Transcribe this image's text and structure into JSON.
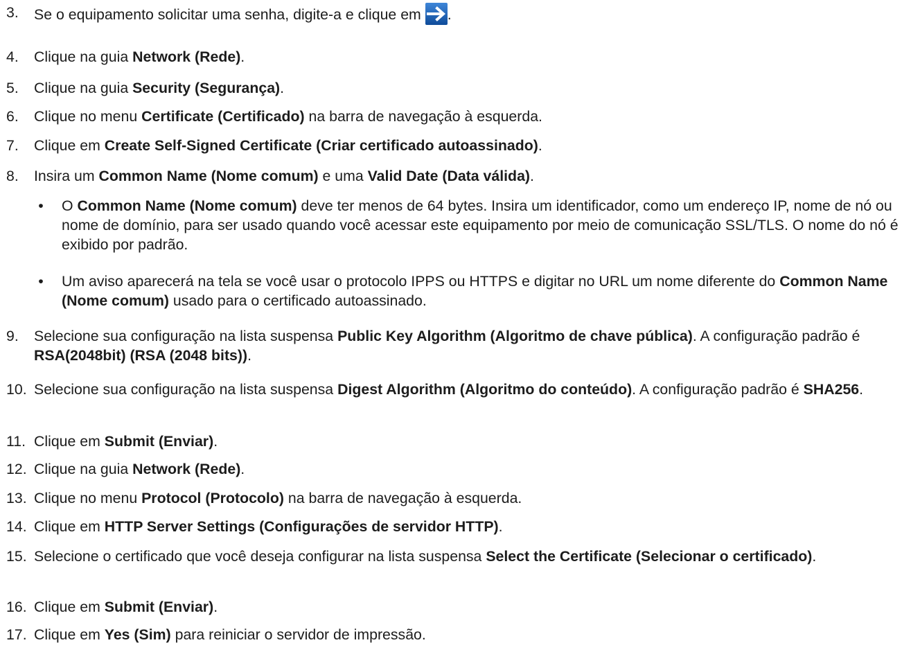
{
  "steps": [
    {
      "num": "3.",
      "parts": [
        {
          "t": "Se o equipamento solicitar uma senha, digite-a e clique em "
        },
        {
          "icon": "arrow-right-icon"
        },
        {
          "t": "."
        }
      ]
    },
    {
      "num": "4.",
      "parts": [
        {
          "t": "Clique na guia "
        },
        {
          "b": "Network (Rede)"
        },
        {
          "t": "."
        }
      ]
    },
    {
      "num": "5.",
      "parts": [
        {
          "t": "Clique na guia "
        },
        {
          "b": "Security (Segurança)"
        },
        {
          "t": "."
        }
      ]
    },
    {
      "num": "6.",
      "parts": [
        {
          "t": "Clique no menu "
        },
        {
          "b": "Certificate (Certificado)"
        },
        {
          "t": " na barra de navegação à esquerda."
        }
      ]
    },
    {
      "num": "7.",
      "parts": [
        {
          "t": "Clique em "
        },
        {
          "b": "Create Self-Signed Certificate (Criar certificado autoassinado)"
        },
        {
          "t": "."
        }
      ]
    },
    {
      "num": "8.",
      "parts": [
        {
          "t": "Insira um "
        },
        {
          "b": "Common Name (Nome comum)"
        },
        {
          "t": " e uma "
        },
        {
          "b": "Valid Date (Data válida)"
        },
        {
          "t": "."
        }
      ]
    },
    {
      "num": "9.",
      "parts": [
        {
          "t": "Selecione sua configuração na lista suspensa "
        },
        {
          "b": "Public Key Algorithm (Algoritmo de chave pública)"
        },
        {
          "t": ". A configuração padrão é "
        },
        {
          "b": "RSA(2048bit) (RSA (2048 bits))"
        },
        {
          "t": "."
        }
      ]
    },
    {
      "num": "10.",
      "parts": [
        {
          "t": "Selecione sua configuração na lista suspensa "
        },
        {
          "b": "Digest Algorithm (Algoritmo do conteúdo)"
        },
        {
          "t": ". A configuração padrão é "
        },
        {
          "b": "SHA256"
        },
        {
          "t": "."
        }
      ]
    },
    {
      "num": "11.",
      "parts": [
        {
          "t": "Clique em "
        },
        {
          "b": "Submit (Enviar)"
        },
        {
          "t": "."
        }
      ]
    },
    {
      "num": "12.",
      "parts": [
        {
          "t": "Clique na guia "
        },
        {
          "b": "Network (Rede)"
        },
        {
          "t": "."
        }
      ]
    },
    {
      "num": "13.",
      "parts": [
        {
          "t": "Clique no menu "
        },
        {
          "b": "Protocol (Protocolo)"
        },
        {
          "t": " na barra de navegação à esquerda."
        }
      ]
    },
    {
      "num": "14.",
      "parts": [
        {
          "t": "Clique em "
        },
        {
          "b": "HTTP Server Settings (Configurações de servidor HTTP)"
        },
        {
          "t": "."
        }
      ]
    },
    {
      "num": "15.",
      "parts": [
        {
          "t": "Selecione o certificado que você deseja configurar na lista suspensa "
        },
        {
          "b": "Select the Certificate (Selecionar o certificado)"
        },
        {
          "t": "."
        }
      ]
    },
    {
      "num": "16.",
      "parts": [
        {
          "t": "Clique em "
        },
        {
          "b": "Submit (Enviar)"
        },
        {
          "t": "."
        }
      ]
    },
    {
      "num": "17.",
      "parts": [
        {
          "t": "Clique em "
        },
        {
          "b": "Yes (Sim)"
        },
        {
          "t": " para reiniciar o servidor de impressão."
        }
      ]
    }
  ],
  "bullets": [
    {
      "mark": "•",
      "parts": [
        {
          "t": "O "
        },
        {
          "b": "Common Name (Nome comum)"
        },
        {
          "t": " deve ter menos de 64 bytes. Insira um identificador, como um endereço IP, nome de nó ou nome de domínio, para ser usado quando você acessar este equipamento por meio de comunicação SSL/TLS. O nome do nó é exibido por padrão."
        }
      ]
    },
    {
      "mark": "•",
      "parts": [
        {
          "t": "Um aviso aparecerá na tela se você usar o protocolo IPPS ou HTTPS e digitar no URL um nome diferente do "
        },
        {
          "b": "Common Name (Nome comum)"
        },
        {
          "t": " usado para o certificado autoassinado."
        }
      ]
    }
  ],
  "colors": {
    "text": "#1c1c1c",
    "icon_bg": "#1a5fb4",
    "icon_arrow": "#ffffff"
  }
}
